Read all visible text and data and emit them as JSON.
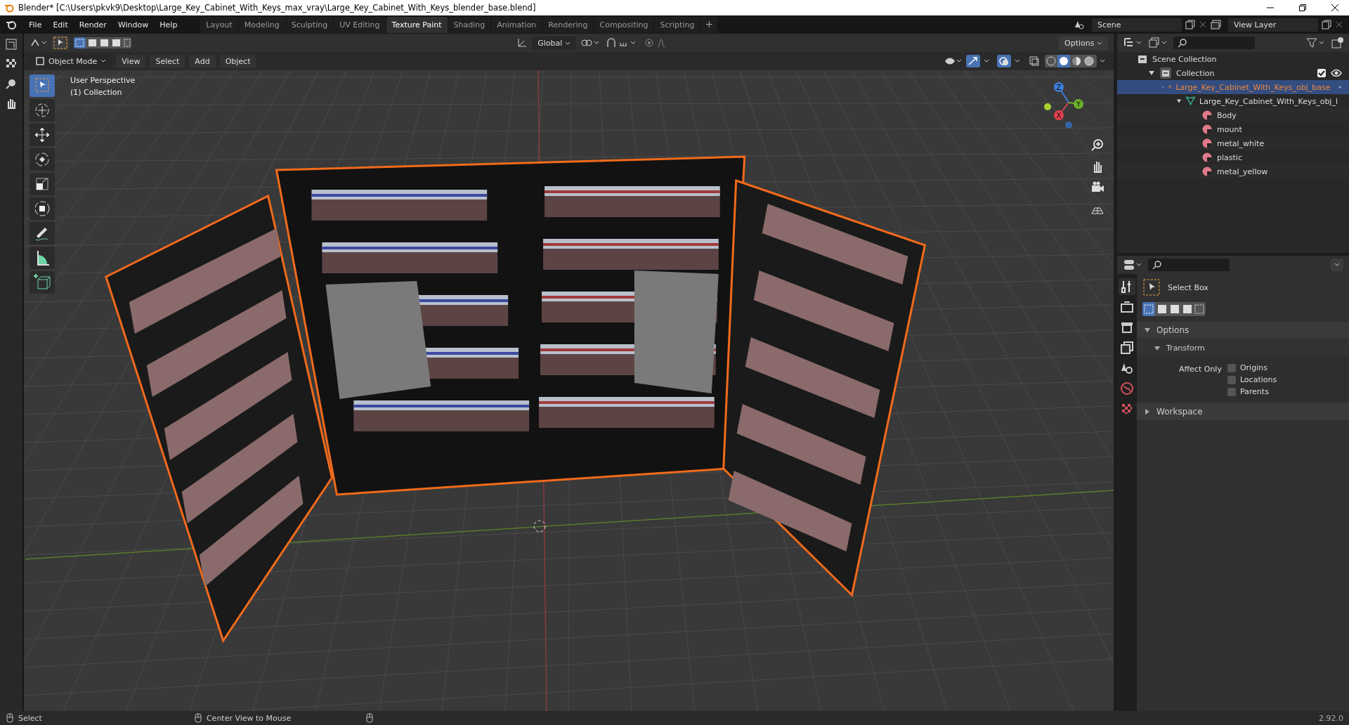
{
  "window": {
    "title": "Blender* [C:\\Users\\pkvk9\\Desktop\\Large_Key_Cabinet_With_Keys_max_vray\\Large_Key_Cabinet_With_Keys_blender_base.blend]"
  },
  "menu": [
    "File",
    "Edit",
    "Render",
    "Window",
    "Help"
  ],
  "workspaces": [
    {
      "label": "Layout",
      "selected": false
    },
    {
      "label": "Modeling",
      "selected": false
    },
    {
      "label": "Sculpting",
      "selected": false
    },
    {
      "label": "UV Editing",
      "selected": false
    },
    {
      "label": "Texture Paint",
      "selected": true
    },
    {
      "label": "Shading",
      "selected": false
    },
    {
      "label": "Animation",
      "selected": false
    },
    {
      "label": "Rendering",
      "selected": false
    },
    {
      "label": "Compositing",
      "selected": false
    },
    {
      "label": "Scripting",
      "selected": false
    }
  ],
  "add_workspace": "+",
  "scene": "Scene",
  "view_layer": "View Layer",
  "tool_header": {
    "orientation": "Global",
    "options": "Options"
  },
  "viewport_header": {
    "mode": "Object Mode",
    "menus": [
      "View",
      "Select",
      "Add",
      "Object"
    ]
  },
  "viewport": {
    "info": [
      "User Perspective",
      "(1) Collection"
    ],
    "gizmo": [
      "X",
      "Y",
      "Z"
    ]
  },
  "outliner": {
    "root": "Scene Collection",
    "items": [
      {
        "label": "Collection",
        "kind": "collection",
        "expanded": true,
        "selected": false,
        "checked": true,
        "children": [
          {
            "label": "Large_Key_Cabinet_With_Keys_obj_base",
            "kind": "object",
            "expanded": true,
            "selected": true,
            "children": [
              {
                "label": "Large_Key_Cabinet_With_Keys_obj_l",
                "kind": "mesh",
                "expanded": true,
                "selected": false,
                "children": [
                  {
                    "label": "Body",
                    "kind": "material",
                    "selected": false
                  },
                  {
                    "label": "mount",
                    "kind": "material",
                    "selected": false
                  },
                  {
                    "label": "metal_white",
                    "kind": "material",
                    "selected": false
                  },
                  {
                    "label": "plastic",
                    "kind": "material",
                    "selected": false
                  },
                  {
                    "label": "metal_yellow",
                    "kind": "material",
                    "selected": false
                  }
                ]
              }
            ]
          }
        ]
      }
    ]
  },
  "properties": {
    "tool": "Select Box",
    "panels": [
      {
        "label": "Options",
        "expanded": true
      },
      {
        "label": "Workspace",
        "expanded": false
      }
    ],
    "subpanel": "Transform",
    "affect_only": "Affect Only",
    "options": [
      {
        "label": "Origins",
        "checked": false
      },
      {
        "label": "Locations",
        "checked": false
      },
      {
        "label": "Parents",
        "checked": false
      }
    ]
  },
  "status_bar": {
    "hints": [
      "Select",
      "Center View to Mouse"
    ],
    "version": "2.92.0"
  }
}
